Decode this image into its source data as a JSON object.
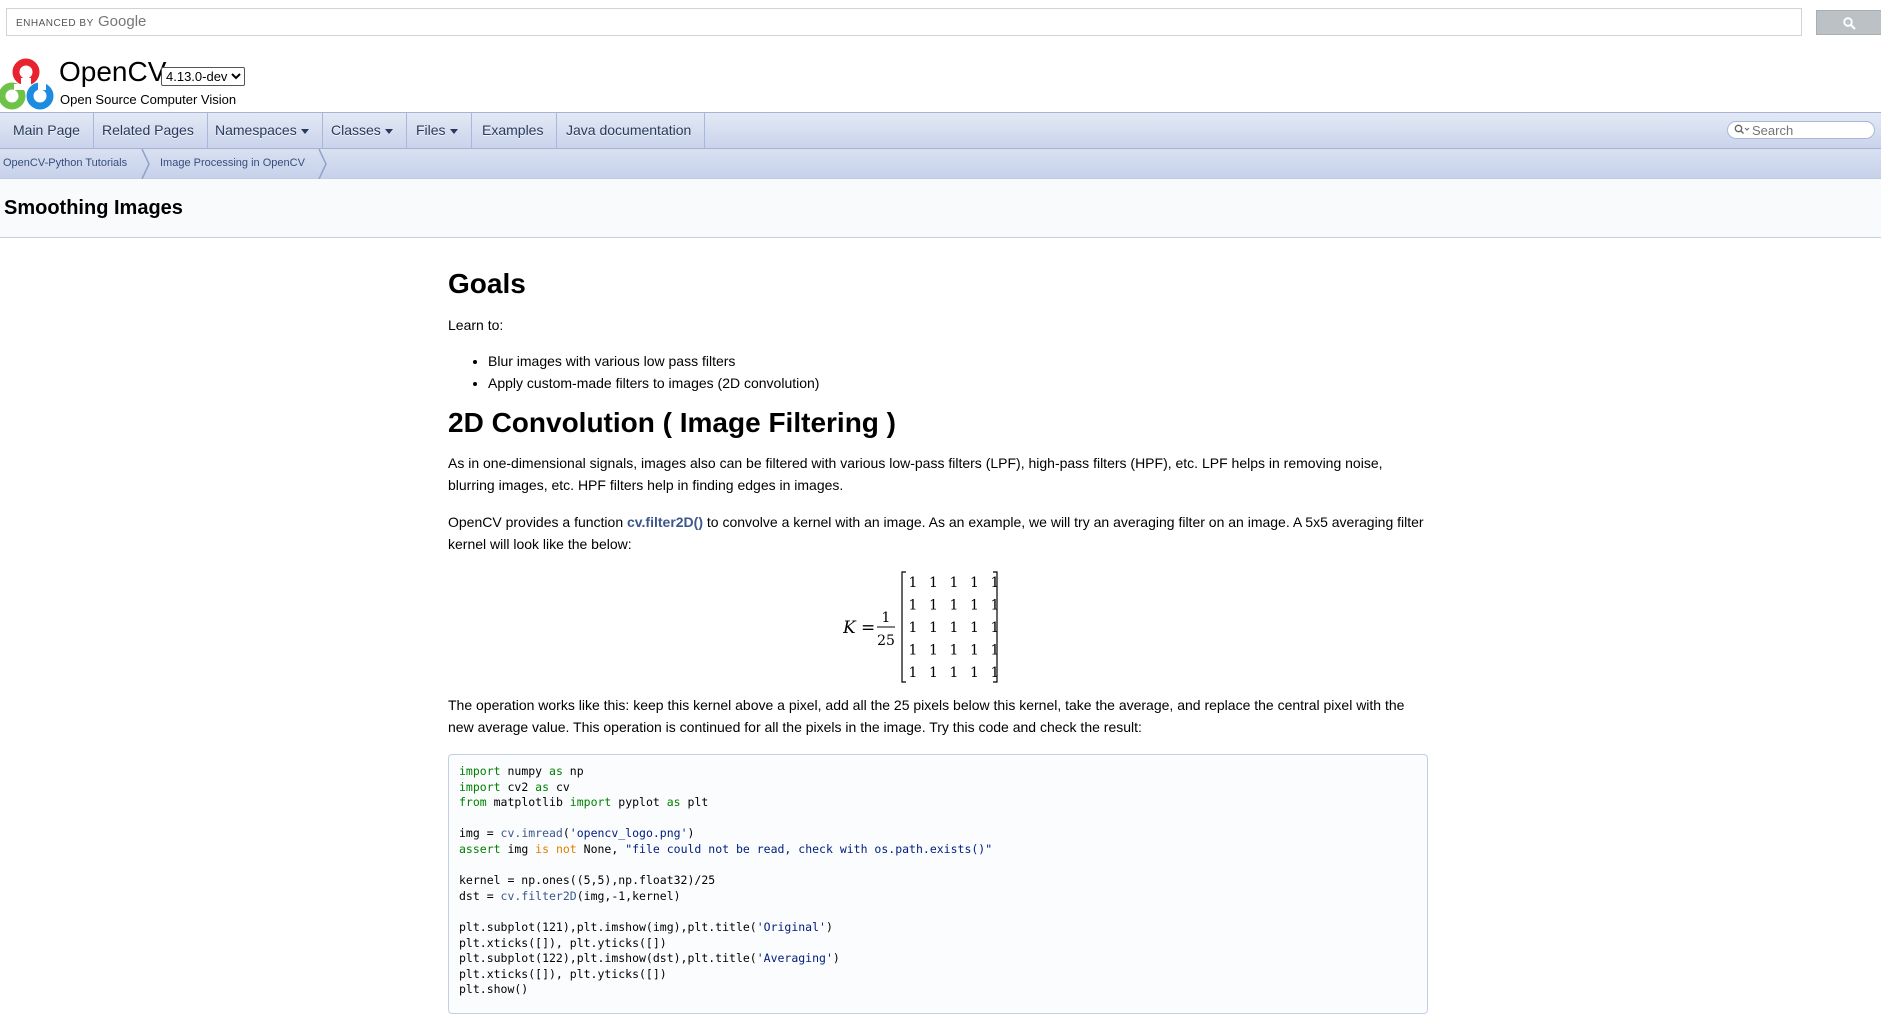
{
  "google_search": {
    "enhanced_by": "ENHANCED BY",
    "brand": "Google"
  },
  "header": {
    "project_name": "OpenCV",
    "version": "4.13.0-dev",
    "project_brief": "Open Source Computer Vision"
  },
  "nav": {
    "items": [
      "Main Page",
      "Related Pages",
      "Namespaces",
      "Classes",
      "Files",
      "Examples",
      "Java documentation"
    ],
    "search_placeholder": "Search"
  },
  "breadcrumb": [
    "OpenCV-Python Tutorials",
    "Image Processing in OpenCV"
  ],
  "page_title": "Smoothing Images",
  "goals": {
    "heading": "Goals",
    "intro": "Learn to:",
    "items": [
      "Blur images with various low pass filters",
      "Apply custom-made filters to images (2D convolution)"
    ]
  },
  "convolution": {
    "heading": "2D Convolution ( Image Filtering )",
    "para1": "As in one-dimensional signals, images also can be filtered with various low-pass filters (LPF), high-pass filters (HPF), etc. LPF helps in removing noise, blurring images, etc. HPF filters help in finding edges in images.",
    "para2_before": "OpenCV provides a function ",
    "para2_link": "cv.filter2D()",
    "para2_after": " to convolve a kernel with an image. As an example, we will try an averaging filter on an image. A 5x5 averaging filter kernel will look like the below:",
    "formula": {
      "lhs": "K",
      "equals": "=",
      "numerator": "1",
      "denominator": "25",
      "matrix": [
        [
          "1",
          "1",
          "1",
          "1",
          "1"
        ],
        [
          "1",
          "1",
          "1",
          "1",
          "1"
        ],
        [
          "1",
          "1",
          "1",
          "1",
          "1"
        ],
        [
          "1",
          "1",
          "1",
          "1",
          "1"
        ],
        [
          "1",
          "1",
          "1",
          "1",
          "1"
        ]
      ]
    },
    "para3": "The operation works like this: keep this kernel above a pixel, add all the 25 pixels below this kernel, take the average, and replace the central pixel with the new average value. This operation is continued for all the pixels in the image. Try this code and check the result:"
  },
  "code": {
    "lines": [
      [
        {
          "t": "import",
          "c": "kw"
        },
        {
          "t": " numpy ",
          "c": ""
        },
        {
          "t": "as",
          "c": "kw"
        },
        {
          "t": " np",
          "c": ""
        }
      ],
      [
        {
          "t": "import",
          "c": "kw"
        },
        {
          "t": " cv2 ",
          "c": ""
        },
        {
          "t": "as",
          "c": "kw"
        },
        {
          "t": " cv",
          "c": ""
        }
      ],
      [
        {
          "t": "from",
          "c": "kw"
        },
        {
          "t": " matplotlib ",
          "c": ""
        },
        {
          "t": "import",
          "c": "kw"
        },
        {
          "t": " pyplot ",
          "c": ""
        },
        {
          "t": "as",
          "c": "kw"
        },
        {
          "t": " plt",
          "c": ""
        }
      ],
      [],
      [
        {
          "t": "img = ",
          "c": ""
        },
        {
          "t": "cv.imread",
          "c": "fn"
        },
        {
          "t": "(",
          "c": ""
        },
        {
          "t": "'opencv_logo.png'",
          "c": "str"
        },
        {
          "t": ")",
          "c": ""
        }
      ],
      [
        {
          "t": "assert",
          "c": "kw"
        },
        {
          "t": " img ",
          "c": ""
        },
        {
          "t": "is not",
          "c": "kw2"
        },
        {
          "t": " None, ",
          "c": ""
        },
        {
          "t": "\"file could not be read, check with os.path.exists()\"",
          "c": "str"
        }
      ],
      [],
      [
        {
          "t": "kernel = np.ones((5,5),np.float32)/25",
          "c": ""
        }
      ],
      [
        {
          "t": "dst = ",
          "c": ""
        },
        {
          "t": "cv.filter2D",
          "c": "fn"
        },
        {
          "t": "(img,-1,kernel)",
          "c": ""
        }
      ],
      [],
      [
        {
          "t": "plt.subplot(121),plt.imshow(img),plt.title(",
          "c": ""
        },
        {
          "t": "'Original'",
          "c": "str"
        },
        {
          "t": ")",
          "c": ""
        }
      ],
      [
        {
          "t": "plt.xticks([]), plt.yticks([])",
          "c": ""
        }
      ],
      [
        {
          "t": "plt.subplot(122),plt.imshow(dst),plt.title(",
          "c": ""
        },
        {
          "t": "'Averaging'",
          "c": "str"
        },
        {
          "t": ")",
          "c": ""
        }
      ],
      [
        {
          "t": "plt.xticks([]), plt.yticks([])",
          "c": ""
        }
      ],
      [
        {
          "t": "plt.show()",
          "c": ""
        }
      ]
    ]
  },
  "colors": {
    "nav_text": "#283a5d",
    "link": "#3d578c",
    "code_keyword": "#008000",
    "code_string": "#002080"
  }
}
